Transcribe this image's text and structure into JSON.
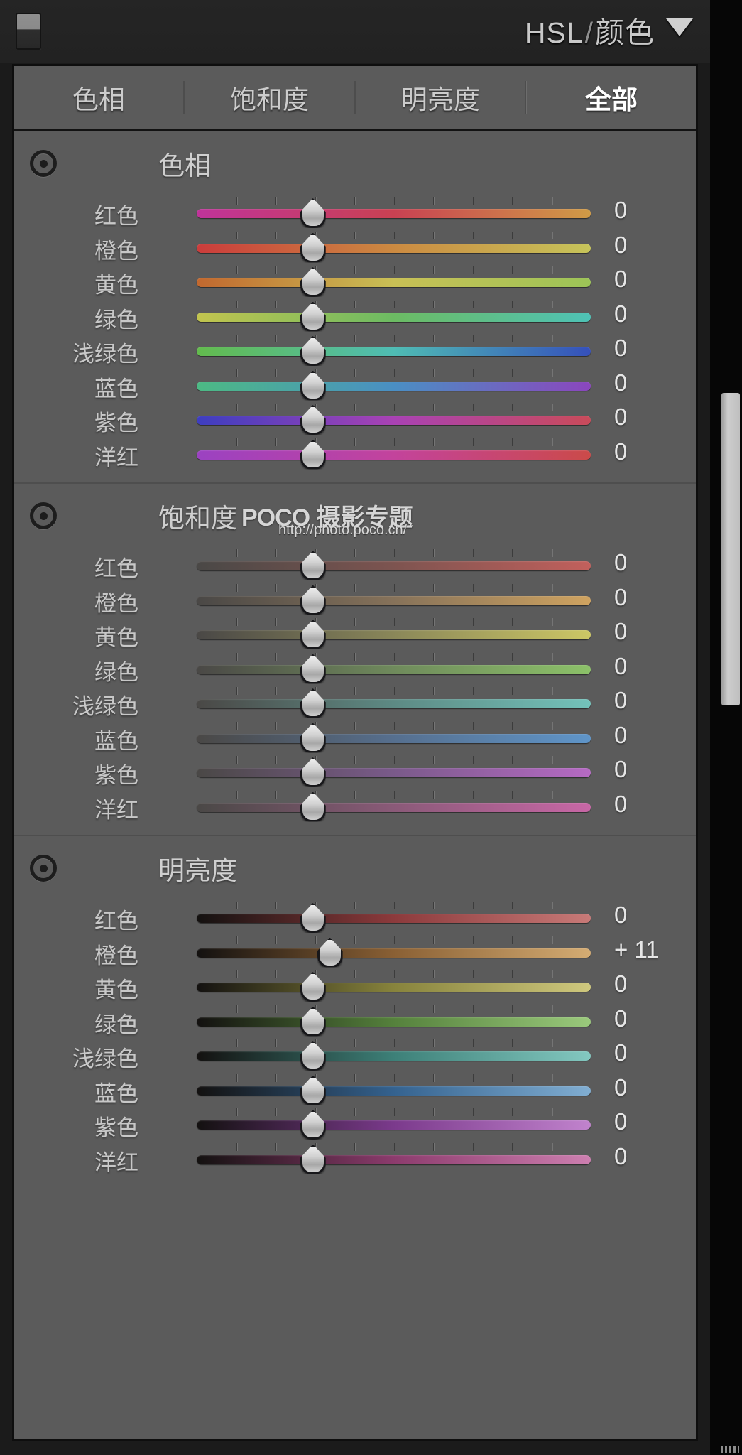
{
  "header": {
    "panel_toggle_icon": "panel-toggle-icon",
    "title_main": "HSL",
    "title_sep": "/",
    "title_sub": "颜色",
    "disclosure_icon": "chevron-down-icon"
  },
  "tabs": [
    {
      "label": "色相",
      "active": false
    },
    {
      "label": "饱和度",
      "active": false
    },
    {
      "label": "明亮度",
      "active": false
    },
    {
      "label": "全部",
      "active": true
    }
  ],
  "watermark": {
    "brand": "POCO",
    "text": "摄影专题",
    "url": "http://photo.poco.cn/"
  },
  "sections": [
    {
      "id": "hue",
      "title": "色相",
      "target_icon": "target-adjust-icon",
      "rows": [
        {
          "label": "红色",
          "value": "0",
          "knob": 29.5,
          "from": "#c0339a",
          "mid": "#c94152",
          "to": "#d09b46"
        },
        {
          "label": "橙色",
          "value": "0",
          "knob": 29.5,
          "from": "#cc3c3c",
          "mid": "#cc8a41",
          "to": "#c6c45a"
        },
        {
          "label": "黄色",
          "value": "0",
          "knob": 29.5,
          "from": "#c2682f",
          "mid": "#c9c055",
          "to": "#9cc457"
        },
        {
          "label": "绿色",
          "value": "0",
          "knob": 29.5,
          "from": "#c2c44e",
          "mid": "#6cbb63",
          "to": "#4ec2b6"
        },
        {
          "label": "浅绿色",
          "value": "0",
          "knob": 29.5,
          "from": "#63bb4d",
          "mid": "#4fbcb4",
          "to": "#3550bb"
        },
        {
          "label": "蓝色",
          "value": "0",
          "knob": 29.5,
          "from": "#4cba84",
          "mid": "#4a8fc4",
          "to": "#8b46bd"
        },
        {
          "label": "紫色",
          "value": "0",
          "knob": 29.5,
          "from": "#3d3ec0",
          "mid": "#a942b4",
          "to": "#c94b5a"
        },
        {
          "label": "洋红",
          "value": "0",
          "knob": 29.5,
          "from": "#9b42c2",
          "mid": "#c3439c",
          "to": "#cb4a49"
        }
      ]
    },
    {
      "id": "saturation",
      "title": "饱和度",
      "target_icon": "target-adjust-icon",
      "rows": [
        {
          "label": "红色",
          "value": "0",
          "knob": 29.5,
          "from": "#4a4846",
          "mid": "#7d5450",
          "to": "#c2605c"
        },
        {
          "label": "橙色",
          "value": "0",
          "knob": 29.5,
          "from": "#4a4846",
          "mid": "#86725a",
          "to": "#cfa360"
        },
        {
          "label": "黄色",
          "value": "0",
          "knob": 29.5,
          "from": "#4a4846",
          "mid": "#8a8759",
          "to": "#cdc765"
        },
        {
          "label": "绿色",
          "value": "0",
          "knob": 29.5,
          "from": "#4a4846",
          "mid": "#6f8a5c",
          "to": "#8cc169"
        },
        {
          "label": "浅绿色",
          "value": "0",
          "knob": 29.5,
          "from": "#4a4846",
          "mid": "#5d8a84",
          "to": "#73c2ba"
        },
        {
          "label": "蓝色",
          "value": "0",
          "knob": 29.5,
          "from": "#4a4846",
          "mid": "#566f8e",
          "to": "#5f95c9"
        },
        {
          "label": "紫色",
          "value": "0",
          "knob": 29.5,
          "from": "#4a4846",
          "mid": "#7a5a8a",
          "to": "#b66ac4"
        },
        {
          "label": "洋红",
          "value": "0",
          "knob": 29.5,
          "from": "#4a4846",
          "mid": "#8a5a78",
          "to": "#c867a6"
        }
      ]
    },
    {
      "id": "luminance",
      "title": "明亮度",
      "target_icon": "target-adjust-icon",
      "rows": [
        {
          "label": "红色",
          "value": "0",
          "knob": 29.5,
          "from": "#131110",
          "mid": "#8c3a3c",
          "to": "#c87a78"
        },
        {
          "label": "橙色",
          "value": "+ 11",
          "knob": 33.8,
          "from": "#131110",
          "mid": "#8a6034",
          "to": "#d4ac73"
        },
        {
          "label": "黄色",
          "value": "0",
          "knob": 29.5,
          "from": "#131110",
          "mid": "#87833c",
          "to": "#cfc87e"
        },
        {
          "label": "绿色",
          "value": "0",
          "knob": 29.5,
          "from": "#131110",
          "mid": "#55813c",
          "to": "#9ac97c"
        },
        {
          "label": "浅绿色",
          "value": "0",
          "knob": 29.5,
          "from": "#131110",
          "mid": "#3d8078",
          "to": "#83c8c0"
        },
        {
          "label": "蓝色",
          "value": "0",
          "knob": 29.5,
          "from": "#131110",
          "mid": "#34628f",
          "to": "#81aed2"
        },
        {
          "label": "紫色",
          "value": "0",
          "knob": 29.5,
          "from": "#131110",
          "mid": "#7b3a8c",
          "to": "#c183cd"
        },
        {
          "label": "洋红",
          "value": "0",
          "knob": 29.5,
          "from": "#131110",
          "mid": "#8c3b6d",
          "to": "#cd7fb0"
        }
      ]
    }
  ],
  "scrollbar": {
    "name": "vertical-scrollbar"
  }
}
